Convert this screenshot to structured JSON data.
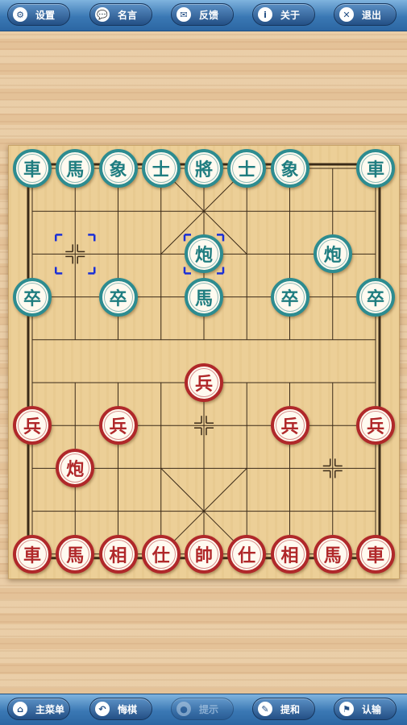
{
  "top_bar": {
    "buttons": [
      {
        "label": "设置",
        "icon": "gear-icon",
        "glyph": "⚙"
      },
      {
        "label": "名言",
        "icon": "speech-bubble-icon",
        "glyph": "💬"
      },
      {
        "label": "反馈",
        "icon": "mail-icon",
        "glyph": "✉"
      },
      {
        "label": "关于",
        "icon": "info-icon",
        "glyph": "i"
      },
      {
        "label": "退出",
        "icon": "close-icon",
        "glyph": "✕"
      }
    ]
  },
  "bottom_bar": {
    "buttons": [
      {
        "label": "主菜单",
        "icon": "home-icon",
        "glyph": "⌂",
        "enabled": true
      },
      {
        "label": "悔棋",
        "icon": "undo-icon",
        "glyph": "↶",
        "enabled": true
      },
      {
        "label": "提示",
        "icon": "bulb-icon",
        "glyph": "●",
        "enabled": false
      },
      {
        "label": "提和",
        "icon": "pen-icon",
        "glyph": "✎",
        "enabled": true
      },
      {
        "label": "认输",
        "icon": "flag-icon",
        "glyph": "⚑",
        "enabled": true
      }
    ]
  },
  "board": {
    "colors": {
      "green": "#2d8c90",
      "red": "#b0282a",
      "line": "#3a2a18"
    },
    "pieces": [
      {
        "side": "green",
        "char": "車",
        "col": 0,
        "row": 0
      },
      {
        "side": "green",
        "char": "馬",
        "col": 1,
        "row": 0
      },
      {
        "side": "green",
        "char": "象",
        "col": 2,
        "row": 0
      },
      {
        "side": "green",
        "char": "士",
        "col": 3,
        "row": 0
      },
      {
        "side": "green",
        "char": "將",
        "col": 4,
        "row": 0
      },
      {
        "side": "green",
        "char": "士",
        "col": 5,
        "row": 0
      },
      {
        "side": "green",
        "char": "象",
        "col": 6,
        "row": 0
      },
      {
        "side": "green",
        "char": "車",
        "col": 8,
        "row": 0
      },
      {
        "side": "green",
        "char": "炮",
        "col": 4,
        "row": 2
      },
      {
        "side": "green",
        "char": "炮",
        "col": 7,
        "row": 2
      },
      {
        "side": "green",
        "char": "卒",
        "col": 0,
        "row": 3
      },
      {
        "side": "green",
        "char": "卒",
        "col": 2,
        "row": 3
      },
      {
        "side": "green",
        "char": "馬",
        "col": 4,
        "row": 3
      },
      {
        "side": "green",
        "char": "卒",
        "col": 6,
        "row": 3
      },
      {
        "side": "green",
        "char": "卒",
        "col": 8,
        "row": 3
      },
      {
        "side": "red",
        "char": "兵",
        "col": 4,
        "row": 5
      },
      {
        "side": "red",
        "char": "兵",
        "col": 0,
        "row": 6
      },
      {
        "side": "red",
        "char": "兵",
        "col": 2,
        "row": 6
      },
      {
        "side": "red",
        "char": "兵",
        "col": 6,
        "row": 6
      },
      {
        "side": "red",
        "char": "兵",
        "col": 8,
        "row": 6
      },
      {
        "side": "red",
        "char": "炮",
        "col": 1,
        "row": 7
      },
      {
        "side": "red",
        "char": "車",
        "col": 0,
        "row": 9
      },
      {
        "side": "red",
        "char": "馬",
        "col": 1,
        "row": 9
      },
      {
        "side": "red",
        "char": "相",
        "col": 2,
        "row": 9
      },
      {
        "side": "red",
        "char": "仕",
        "col": 3,
        "row": 9
      },
      {
        "side": "red",
        "char": "帥",
        "col": 4,
        "row": 9
      },
      {
        "side": "red",
        "char": "仕",
        "col": 5,
        "row": 9
      },
      {
        "side": "red",
        "char": "相",
        "col": 6,
        "row": 9
      },
      {
        "side": "red",
        "char": "馬",
        "col": 7,
        "row": 9
      },
      {
        "side": "red",
        "char": "車",
        "col": 8,
        "row": 9
      }
    ],
    "selection_markers": [
      {
        "col": 1,
        "row": 2
      },
      {
        "col": 4,
        "row": 2
      }
    ],
    "position_marks": [
      {
        "col": 4,
        "row": 6
      },
      {
        "col": 7,
        "row": 7
      }
    ]
  }
}
